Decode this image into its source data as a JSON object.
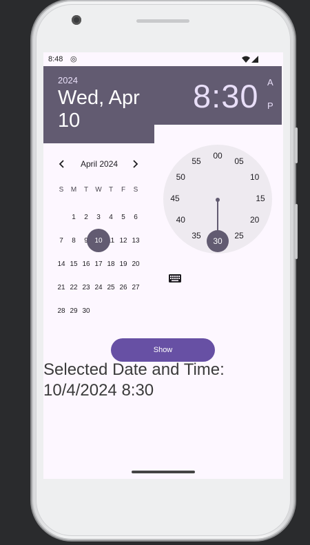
{
  "status_bar": {
    "time": "8:48"
  },
  "header": {
    "year": "2024",
    "date": "Wed, Apr 10",
    "time": "8:30",
    "am": "A",
    "pm": "P"
  },
  "calendar": {
    "month_label": "April 2024",
    "prev_icon": "chevron-left-icon",
    "next_icon": "chevron-right-icon",
    "weekdays": [
      "S",
      "M",
      "T",
      "W",
      "T",
      "F",
      "S"
    ],
    "days": [
      "1",
      "2",
      "3",
      "4",
      "5",
      "6",
      "7",
      "8",
      "9",
      "10",
      "11",
      "12",
      "13",
      "14",
      "15",
      "16",
      "17",
      "18",
      "19",
      "20",
      "21",
      "22",
      "23",
      "24",
      "25",
      "26",
      "27",
      "28",
      "29",
      "30"
    ],
    "first_day_offset": 1,
    "selected_day": "10"
  },
  "clock": {
    "numbers": [
      "00",
      "05",
      "10",
      "15",
      "20",
      "25",
      "30",
      "35",
      "40",
      "45",
      "50",
      "55"
    ],
    "selected": "30"
  },
  "keyboard_icon": "keyboard-icon",
  "show_button": {
    "label": "Show"
  },
  "result": {
    "label": "Selected Date and Time:",
    "value": "10/4/2024 8:30"
  },
  "colors": {
    "header": "#625b71",
    "button": "#6750a4",
    "screen": "#fdf7ff"
  }
}
